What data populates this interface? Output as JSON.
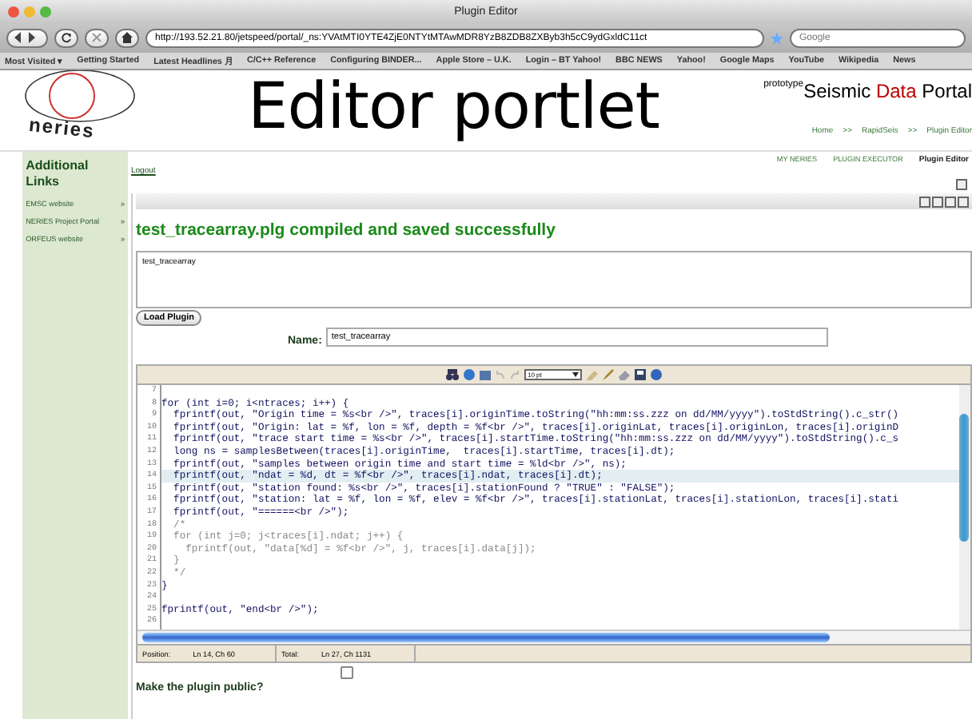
{
  "window": {
    "title": "Plugin Editor"
  },
  "browser": {
    "url": "http://193.52.21.80/jetspeed/portal/_ns:YVAtMTI0YTE4ZjE0NTYtMTAwMDR8YzB8ZDB8ZXByb3h5cC9ydGxldC11ct",
    "search_placeholder": "Google",
    "bookmarks": [
      "Most Visited ▾",
      "Getting Started",
      "Latest Headlines ⽉",
      "C/C++ Reference",
      "Configuring BINDER...",
      "Apple Store – U.K.",
      "Login – BT Yahoo!",
      "BBC NEWS",
      "Yahoo!",
      "Google Maps",
      "YouTube",
      "Wikipedia",
      "News"
    ]
  },
  "header": {
    "logo_text": "neries",
    "title": "Editor portlet",
    "tag": "prototype",
    "brand_parts": [
      "Seismic ",
      "Data",
      " Portal"
    ],
    "breadcrumb": [
      "Home",
      ">>",
      "RapidSeis",
      ">>",
      "Plugin Editor"
    ]
  },
  "nav": [
    {
      "label": "MY NERIES",
      "selected": false
    },
    {
      "label": "PLUGIN EXECUTOR",
      "selected": false
    },
    {
      "label": "Plugin Editor",
      "selected": true
    }
  ],
  "sidebar": {
    "title": "Additional Links",
    "items": [
      {
        "label": "EMSC website",
        "arrow": "»"
      },
      {
        "label": "NERIES Project Portal",
        "arrow": "»"
      },
      {
        "label": "ORFEUS website",
        "arrow": "»"
      }
    ]
  },
  "logout": "Logout",
  "message": "test_tracearray.plg compiled and saved successfully",
  "plugin_list": [
    "test_tracearray"
  ],
  "load_button": "Load Plugin",
  "name_field": {
    "label": "Name:",
    "value": "test_tracearray"
  },
  "editor": {
    "font_size": "10 pt",
    "lines": [
      {
        "num": "7",
        "kind": "code",
        "highlighted": false
      },
      {
        "num": "8",
        "kind": "code",
        "highlighted": false,
        "code": "for (int i=0; i<ntraces; i++) {"
      },
      {
        "num": "9",
        "kind": "code",
        "highlighted": false,
        "code": "  fprintf(out, \"Origin time = %s<br />\", traces[i].originTime.toString(\"hh:mm:ss.zzz on dd/MM/yyyy\").toStdString().c_str()"
      },
      {
        "num": "10",
        "kind": "code",
        "highlighted": false,
        "code": "  fprintf(out, \"Origin: lat = %f, lon = %f, depth = %f<br />\", traces[i].originLat, traces[i].originLon, traces[i].originD"
      },
      {
        "num": "11",
        "kind": "code",
        "highlighted": false,
        "code": "  fprintf(out, \"trace start time = %s<br />\", traces[i].startTime.toString(\"hh:mm:ss.zzz on dd/MM/yyyy\").toStdString().c_s"
      },
      {
        "num": "12",
        "kind": "code",
        "highlighted": false,
        "code": "  long ns = samplesBetween(traces[i].originTime,  traces[i].startTime, traces[i].dt);"
      },
      {
        "num": "13",
        "kind": "code",
        "highlighted": false,
        "code": "  fprintf(out, \"samples between origin time and start time = %ld<br />\", ns);"
      },
      {
        "num": "14",
        "kind": "code",
        "highlighted": true,
        "code": "  fprintf(out, \"ndat = %d, dt = %f<br />\", traces[i].ndat, traces[i].dt);"
      },
      {
        "num": "15",
        "kind": "code",
        "highlighted": false,
        "code": "  fprintf(out, \"station found: %s<br />\", traces[i].stationFound ? \"TRUE\" : \"FALSE\");"
      },
      {
        "num": "16",
        "kind": "code",
        "highlighted": false,
        "code": "  fprintf(out, \"station: lat = %f, lon = %f, elev = %f<br />\", traces[i].stationLat, traces[i].stationLon, traces[i].stati"
      },
      {
        "num": "17",
        "kind": "code",
        "highlighted": false,
        "code": "  fprintf(out, \"======<br />\");"
      },
      {
        "num": "18",
        "kind": "comment",
        "highlighted": false,
        "code": "  /*"
      },
      {
        "num": "19",
        "kind": "comment",
        "highlighted": false,
        "code": "  for (int j=0; j<traces[i].ndat; j++) {"
      },
      {
        "num": "20",
        "kind": "comment",
        "highlighted": false,
        "code": "    fprintf(out, \"data[%d] = %f<br />\", j, traces[i].data[j]);"
      },
      {
        "num": "21",
        "kind": "comment",
        "highlighted": false,
        "code": "  }"
      },
      {
        "num": "22",
        "kind": "comment",
        "highlighted": false,
        "code": "  */"
      },
      {
        "num": "23",
        "kind": "code",
        "highlighted": false,
        "code": "}"
      },
      {
        "num": "24",
        "kind": "code",
        "highlighted": false
      },
      {
        "num": "25",
        "kind": "code",
        "highlighted": false,
        "code": "fprintf(out, \"end<br />\");"
      },
      {
        "num": "26",
        "kind": "code",
        "highlighted": false
      }
    ],
    "status": [
      {
        "label": "Position:",
        "value": "Ln 14, Ch 60"
      },
      {
        "label": "Total:",
        "value": "Ln 27, Ch 1131"
      }
    ]
  },
  "public_checkbox": {
    "label": "Make the plugin public?",
    "checked": false
  }
}
